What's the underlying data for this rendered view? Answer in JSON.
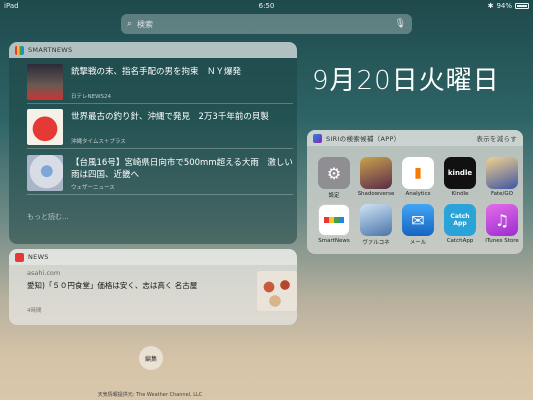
{
  "status_bar": {
    "device": "iPad",
    "time": "6:50",
    "battery": "94%"
  },
  "search": {
    "placeholder": "検索"
  },
  "date": "9月20日火曜日",
  "smartnews": {
    "header": "SMARTNEWS",
    "items": [
      {
        "title": "銃撃戦の末、指名手配の男を拘束　ＮＹ爆発",
        "source": "日テレNEWS24"
      },
      {
        "title": "世界最古の釣り針、沖縄で発見　2万3千年前の貝製",
        "source": "沖縄タイムス＋プラス"
      },
      {
        "title": "【台風16号】宮崎県日向市で500mm超える大雨　激しい雨は四国、近畿へ",
        "source": "ウェザーニュース"
      }
    ],
    "more": "もっと読む..."
  },
  "news": {
    "header": "NEWS",
    "site": "asahi.com",
    "title": "愛知)「５０円食堂」価格は安く、志は高く 名古屋",
    "time": "4時間"
  },
  "siri": {
    "header": "SIRIの検索候補（APP）",
    "show_less": "表示を減らす",
    "apps": [
      {
        "label": "設定",
        "color": "#8e8e93",
        "icon": "gear-icon"
      },
      {
        "label": "Shadowverse",
        "color": "#3b2a3a",
        "icon": "shadowverse-icon"
      },
      {
        "label": "Analytics",
        "color": "#ffffff",
        "icon": "analytics-icon"
      },
      {
        "label": "Kindle",
        "color": "#111111",
        "icon": "kindle-icon"
      },
      {
        "label": "Fate/GO",
        "color": "#4a5aa8",
        "icon": "fate-icon"
      },
      {
        "label": "SmartNews",
        "color": "#ffffff",
        "icon": "smartnews-icon"
      },
      {
        "label": "ヴァルコネ",
        "color": "#5a8ab8",
        "icon": "valkone-icon"
      },
      {
        "label": "メール",
        "color": "#1e88e5",
        "icon": "mail-icon"
      },
      {
        "label": "CatchApp",
        "color": "#2aa4d8",
        "icon": "catchapp-icon"
      },
      {
        "label": "iTunes Store",
        "color": "#c247d6",
        "icon": "itunes-icon"
      }
    ]
  },
  "edit_label": "編集",
  "footer": "天気情報提供元: The Weather Channel, LLC"
}
